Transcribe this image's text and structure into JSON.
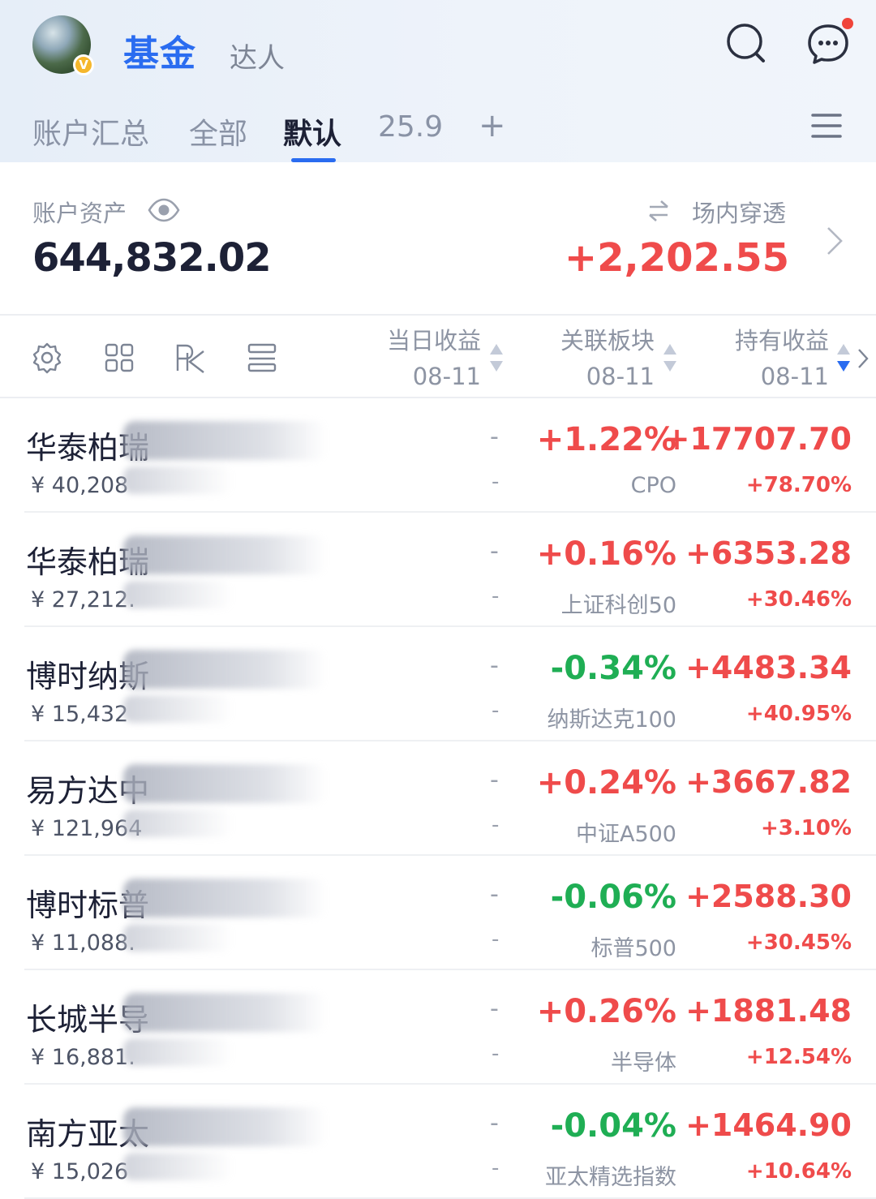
{
  "header": {
    "title": "基金",
    "subtitle": "达人",
    "avatar_badge": "V",
    "icons": [
      "search-icon",
      "chat-icon"
    ],
    "notification_dot_color": "#f0443a"
  },
  "tabs": [
    {
      "label": "账户汇总",
      "active": false
    },
    {
      "label": "全部",
      "active": false
    },
    {
      "label": "默认",
      "active": true
    },
    {
      "label": "25.9",
      "active": false
    },
    {
      "label": "+",
      "active": false
    }
  ],
  "account": {
    "label": "账户资产",
    "value": "644,832.02",
    "penetration_label": "场内穿透",
    "penetration_value": "+2,202.55"
  },
  "columns": {
    "daily_income": {
      "label": "当日收益",
      "date": "08-11"
    },
    "sector": {
      "label": "关联板块",
      "date": "08-11"
    },
    "holding_income": {
      "label": "持有收益",
      "date": "08-11"
    }
  },
  "funds": [
    {
      "name": "华泰柏瑞",
      "amount": "¥ 40,208",
      "daily": "-",
      "daily_sub": "-",
      "pct": "+1.22%",
      "trend": "up",
      "sector": "CPO",
      "hold": "+17707.70",
      "hold_pct": "+78.70%"
    },
    {
      "name": "华泰柏瑞",
      "amount": "¥ 27,212.",
      "daily": "-",
      "daily_sub": "-",
      "pct": "+0.16%",
      "trend": "up",
      "sector": "上证科创50",
      "hold": "+6353.28",
      "hold_pct": "+30.46%"
    },
    {
      "name": "博时纳斯",
      "amount": "¥ 15,432",
      "daily": "-",
      "daily_sub": "-",
      "pct": "-0.34%",
      "trend": "down",
      "sector": "纳斯达克100",
      "hold": "+4483.34",
      "hold_pct": "+40.95%"
    },
    {
      "name": "易方达中",
      "amount": "¥ 121,964",
      "daily": "-",
      "daily_sub": "-",
      "pct": "+0.24%",
      "trend": "up",
      "sector": "中证A500",
      "hold": "+3667.82",
      "hold_pct": "+3.10%"
    },
    {
      "name": "博时标普",
      "amount": "¥ 11,088.",
      "daily": "-",
      "daily_sub": "-",
      "pct": "-0.06%",
      "trend": "down",
      "sector": "标普500",
      "hold": "+2588.30",
      "hold_pct": "+30.45%"
    },
    {
      "name": "长城半导",
      "amount": "¥ 16,881.",
      "daily": "-",
      "daily_sub": "-",
      "pct": "+0.26%",
      "trend": "up",
      "sector": "半导体",
      "hold": "+1881.48",
      "hold_pct": "+12.54%"
    },
    {
      "name": "南方亚太",
      "amount": "¥ 15,026",
      "daily": "-",
      "daily_sub": "-",
      "pct": "-0.04%",
      "trend": "down",
      "sector": "亚太精选指数",
      "hold": "+1464.90",
      "hold_pct": "+10.64%"
    }
  ],
  "colors": {
    "accent": "#2a6cf0",
    "up": "#ef4b4b",
    "down": "#1fae54"
  }
}
